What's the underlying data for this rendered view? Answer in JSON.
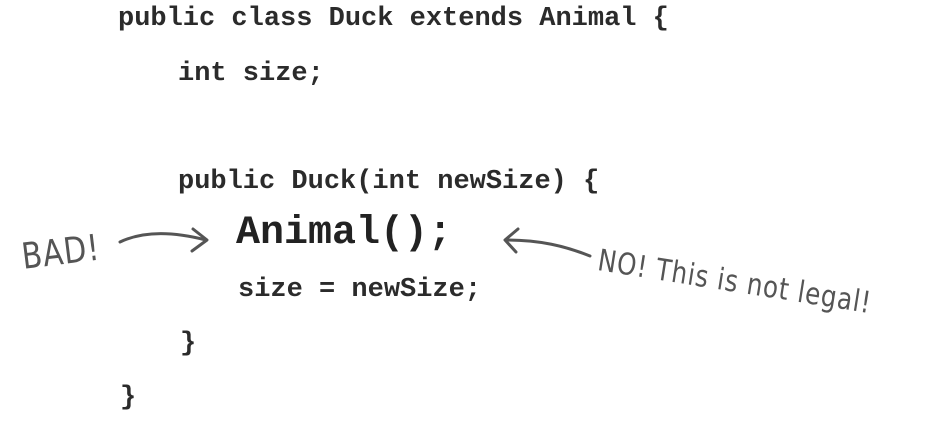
{
  "code": {
    "line1": "public class Duck extends Animal {",
    "line2": "int size;",
    "line3": "public Duck(int newSize) {",
    "line4": "Animal();",
    "line5": "size = newSize;",
    "line6": "}",
    "line7": "}"
  },
  "annotations": {
    "bad": "BAD!",
    "not_legal": "NO! This is not legal!"
  },
  "colors": {
    "code_text": "#2b2b2b",
    "annotation": "#555555"
  }
}
